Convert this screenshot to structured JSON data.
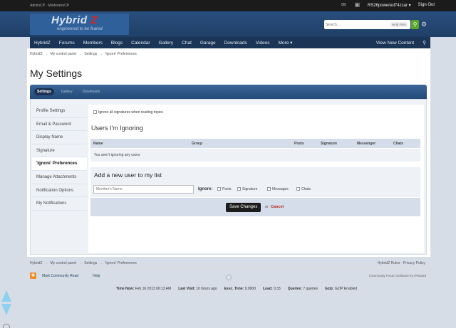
{
  "topbar": {
    "left_text": "AdminCP · ModeratorCP",
    "username": "RS26powered74zcar",
    "sign_out": "Sign Out",
    "icons": [
      "envelope-icon",
      "person-icon"
    ]
  },
  "logo": {
    "name_part1": "Hybrid",
    "name_part2": "Z",
    "tagline": "engineered to be feared"
  },
  "search": {
    "placeholder": "Search...",
    "scope": "Help Files",
    "icon": "search-icon"
  },
  "nav": {
    "items": [
      "HybridZ",
      "Forums",
      "Members",
      "Blogs",
      "Calendar",
      "Gallery",
      "Chat",
      "Garage",
      "Downloads",
      "Videos",
      "More"
    ],
    "right": "View New Content"
  },
  "breadcrumb": [
    "HybridZ",
    "My control panel",
    "Settings",
    "'Ignore' Preferences"
  ],
  "page_title": "My Settings",
  "tabs": [
    "Settings",
    "Gallery",
    "Downloads"
  ],
  "sidebar": {
    "items": [
      "Profile Settings",
      "Email & Password",
      "Display Name",
      "Signature",
      "'Ignore' Preferences",
      "Manage Attachments",
      "Notification Options",
      "My Notifications"
    ],
    "active_index": 4
  },
  "ignore_signatures": {
    "label": "Ignore all signatures when reading topics",
    "checked": false
  },
  "ignoring": {
    "heading": "Users I'm Ignoring",
    "columns": [
      "Name",
      "Group",
      "Posts",
      "Signature",
      "Messenger",
      "Chats"
    ],
    "empty_text": "You aren't ignoring any users"
  },
  "add_user": {
    "heading": "Add a new user to my list",
    "placeholder": "Member's Name",
    "ignore_label": "Ignore:",
    "options": [
      "Posts",
      "Signature",
      "Messages",
      "Chats"
    ]
  },
  "actions": {
    "save": "Save Changes",
    "or": "or",
    "cancel": "Cancel"
  },
  "footer": {
    "breadcrumb": [
      "HybridZ",
      "My control panel",
      "Settings",
      "'Ignore' Preferences"
    ],
    "links": "HybridZ Rules · Privacy Policy",
    "mark_read": "Mark Community Read",
    "help": "Help",
    "powered_by": "Community Forum Software by IP.Board",
    "stats": [
      {
        "label": "Time Now:",
        "value": "Feb 16 2013 06:13 AM"
      },
      {
        "label": "Last Visit:",
        "value": "10 hours ago"
      },
      {
        "label": "Exec. Time:",
        "value": "0.0900"
      },
      {
        "label": "Load:",
        "value": "0.33"
      },
      {
        "label": "Queries:",
        "value": "7 queries"
      },
      {
        "label": "Gzip:",
        "value": "GZIP Enabled"
      }
    ]
  },
  "colors": {
    "header_blue": "#234a78",
    "nav_dark": "#1a3556",
    "accent_green": "#58a528",
    "cancel_red": "#b41f1f",
    "rss_orange": "#f08a24"
  }
}
